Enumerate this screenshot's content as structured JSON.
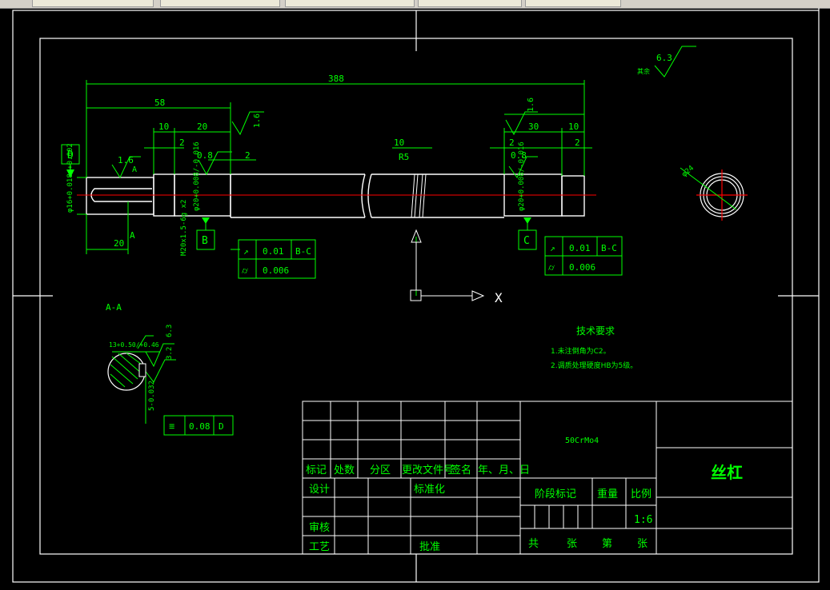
{
  "app": {
    "toolbar_tabs": [
      "",
      "",
      "",
      "",
      ""
    ]
  },
  "colors": {
    "background": "#000000",
    "lines": "#ffffff",
    "annotation": "#00ff00",
    "centerline": "#ff0000",
    "cursor": "#ffffff"
  },
  "drawing": {
    "dims": {
      "total_length": "388",
      "left_len": "58",
      "step1": "10",
      "step2": "20",
      "step3": "2",
      "step4": "0.8",
      "step5": "2",
      "right1": "30",
      "right2": "10",
      "right3": "2",
      "right4": "2",
      "right5": "0.8",
      "mid": "10",
      "r5": "R5",
      "key_len": "20",
      "diam_left": "φ16+0.018/+0.002",
      "diam_b": "φ20+0.008/-0.016",
      "diam_c": "φ20+0.008/-0.016",
      "thread": "M20x1.5-6g x2",
      "rough_left": "1.6",
      "rough_b": "1.6",
      "rough_c": "1.6",
      "diam_section": "φ24"
    },
    "labels": {
      "d": "D",
      "a": "A",
      "a2": "A",
      "b": "B",
      "c": "C",
      "view": "A-A",
      "x": "X"
    },
    "tolerance_b": {
      "sym1": "↗",
      "val1": "0.01",
      "ref1": "B-C",
      "sym2": "⌭",
      "val2": "0.006"
    },
    "tolerance_c": {
      "sym1": "↗",
      "val1": "0.01",
      "ref1": "B-C",
      "sym2": "⌭",
      "val2": "0.006"
    },
    "section": {
      "dim1": "13+0.50/+0.46",
      "rough1": "6.3",
      "rough2": "3.2",
      "dim2": "5-0.032",
      "sym_tol": "≡",
      "tol_val": "0.08",
      "tol_ref": "D"
    },
    "roughness_top": {
      "value": "6.3",
      "label": "其余"
    },
    "tech_req": {
      "title": "技术要求",
      "line1": "1.未注倒角为C2。",
      "line2": "2.调质处理硬度HB为5级。"
    }
  },
  "title_block": {
    "material": "50CrMo4",
    "part_name": "丝杠",
    "row_labels": [
      "标记",
      "处数",
      "分区",
      "更改文件号",
      "签名",
      "年、月、日"
    ],
    "design": "设计",
    "standard": "标准化",
    "review": "审核",
    "process": "工艺",
    "approve": "批准",
    "stage": "阶段标记",
    "weight": "重量",
    "scale_label": "比例",
    "scale": "1:6",
    "sheets": [
      "共",
      "张",
      "第",
      "张"
    ]
  }
}
